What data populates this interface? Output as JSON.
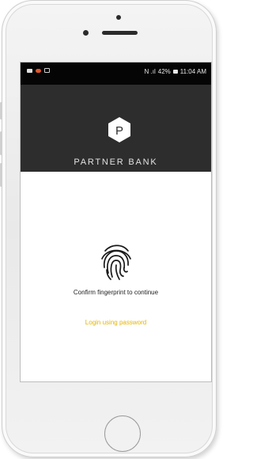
{
  "status_bar": {
    "left_icons": [
      "image-icon",
      "notification-dot-icon",
      "app-icon"
    ],
    "indicators": "N .ıl",
    "battery": "42%",
    "time": "11:04 AM"
  },
  "brand": {
    "logo_letter": "P",
    "name": "PARTNER BANK"
  },
  "auth": {
    "prompt": "Confirm fingerprint to continue",
    "password_link": "Login using password"
  },
  "colors": {
    "header_bg": "#2d2d2d",
    "link": "#e4b400",
    "status_bg": "#050505"
  }
}
